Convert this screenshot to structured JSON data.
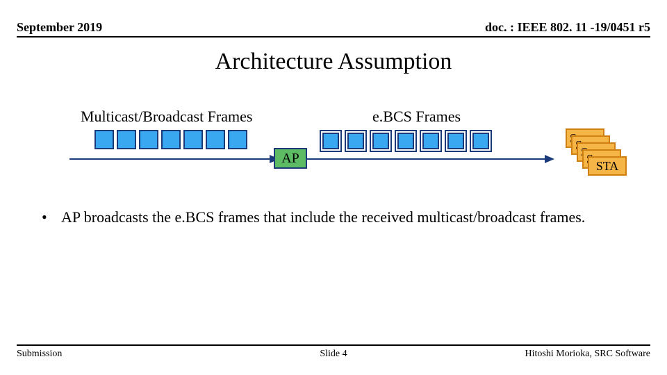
{
  "header": {
    "left": "September 2019",
    "right": "doc. : IEEE 802. 11 -19/0451 r5"
  },
  "title": "Architecture Assumption",
  "diagram": {
    "label_left": "Multicast/Broadcast Frames",
    "label_right": "e.BCS Frames",
    "ap_label": "AP",
    "sta_label": "STA",
    "sta_count": 5,
    "left_frames": {
      "count": 7,
      "highlight_indices": []
    },
    "right_frames": {
      "count": 7,
      "highlight_indices": [
        0,
        1,
        2,
        3,
        4,
        5,
        6
      ]
    },
    "colors": {
      "frame_fill": "#39a8f1",
      "frame_border": "#1a3a7a",
      "ap_fill": "#5dbb63",
      "sta_fill": "#f6b547",
      "sta_border": "#d08010"
    }
  },
  "bullets": [
    "AP broadcasts the e.BCS frames that include the received multicast/broadcast frames."
  ],
  "footer": {
    "left": "Submission",
    "center": "Slide 4",
    "right": "Hitoshi Morioka, SRC Software"
  }
}
